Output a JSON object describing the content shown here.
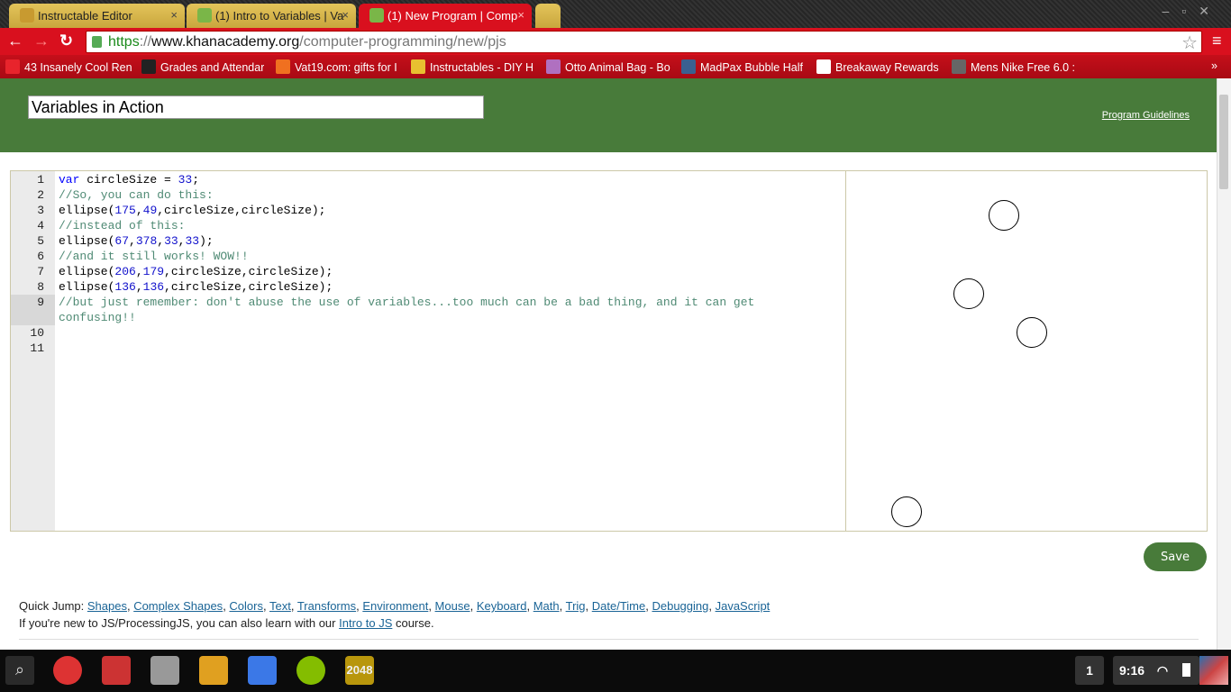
{
  "browser": {
    "tabs": [
      {
        "title": "Instructable Editor",
        "icon": "robot-icon",
        "active": false
      },
      {
        "title": "(1) Intro to Variables | Va",
        "icon": "leaf-icon",
        "active": false
      },
      {
        "title": "(1) New Program | Comp",
        "icon": "leaf-icon",
        "active": true
      }
    ],
    "url": {
      "scheme": "https",
      "sep": "://",
      "domain": "www.khanacademy.org",
      "path": "/computer-programming/new/pjs"
    },
    "bookmarks": [
      {
        "label": "43 Insanely Cool Ren",
        "icon": "bf-icon",
        "color": "#e8242c"
      },
      {
        "label": "Grades and Attendar",
        "icon": "p-icon",
        "color": "#222"
      },
      {
        "label": "Vat19.com: gifts for I",
        "icon": "cart-play-icon",
        "color": "#f07020"
      },
      {
        "label": "Instructables - DIY H",
        "icon": "robot-icon",
        "color": "#e8c030"
      },
      {
        "label": "Otto Animal Bag - Bo",
        "icon": "cart-icon",
        "color": "#b070c0"
      },
      {
        "label": "MadPax Bubble Half",
        "icon": "z-icon",
        "color": "#3a6090"
      },
      {
        "label": "Breakaway Rewards",
        "icon": "shirt-icon",
        "color": "#fff"
      },
      {
        "label": "Mens Nike Free 6.0 :",
        "icon": "nike-icon",
        "color": "#666"
      }
    ],
    "more": "»"
  },
  "header": {
    "program_title": "Variables in Action",
    "guidelines": "Program Guidelines"
  },
  "editor": {
    "line_numbers": [
      "1",
      "2",
      "3",
      "4",
      "5",
      "6",
      "7",
      "8",
      "9",
      "10",
      "11"
    ],
    "lines": [
      [
        [
          "k",
          "var"
        ],
        [
          "t",
          " circleSize = "
        ],
        [
          "n",
          "33"
        ],
        [
          "t",
          ";"
        ]
      ],
      [
        [
          "c",
          "//So, you can do this:"
        ]
      ],
      [
        [
          "t",
          "ellipse("
        ],
        [
          "n",
          "175"
        ],
        [
          "t",
          ","
        ],
        [
          "n",
          "49"
        ],
        [
          "t",
          ",circleSize,circleSize);"
        ]
      ],
      [
        [
          "c",
          "//instead of this:"
        ]
      ],
      [
        [
          "t",
          "ellipse("
        ],
        [
          "n",
          "67"
        ],
        [
          "t",
          ","
        ],
        [
          "n",
          "378"
        ],
        [
          "t",
          ","
        ],
        [
          "n",
          "33"
        ],
        [
          "t",
          ","
        ],
        [
          "n",
          "33"
        ],
        [
          "t",
          ");"
        ]
      ],
      [
        [
          "c",
          "//and it still works! WOW!!"
        ]
      ],
      [
        [
          "t",
          "ellipse("
        ],
        [
          "n",
          "206"
        ],
        [
          "t",
          ","
        ],
        [
          "n",
          "179"
        ],
        [
          "t",
          ",circleSize,circleSize);"
        ]
      ],
      [
        [
          "t",
          "ellipse("
        ],
        [
          "n",
          "136"
        ],
        [
          "t",
          ","
        ],
        [
          "n",
          "136"
        ],
        [
          "t",
          ",circleSize,circleSize);"
        ]
      ],
      [
        [
          "c",
          "//but just remember: don't abuse the use of variables...too much can be a bad thing, and it can get confusing!!"
        ]
      ],
      [],
      []
    ],
    "active_line": 9
  },
  "canvas": {
    "ellipses": [
      [
        175,
        49,
        33,
        33
      ],
      [
        67,
        378,
        33,
        33
      ],
      [
        206,
        179,
        33,
        33
      ],
      [
        136,
        136,
        33,
        33
      ]
    ]
  },
  "save_label": "Save",
  "quick_jump": {
    "prefix": "Quick Jump: ",
    "links": [
      "Shapes",
      "Complex Shapes",
      "Colors",
      "Text",
      "Transforms",
      "Environment",
      "Mouse",
      "Keyboard",
      "Math",
      "Trig",
      "Date/Time",
      "Debugging",
      "JavaScript"
    ],
    "intro_prefix": "If you're new to JS/ProcessingJS, you can also learn with our ",
    "intro_link": "Intro to JS",
    "intro_suffix": " course."
  },
  "shelf": {
    "apps": [
      {
        "name": "chrome",
        "color": "#d33"
      },
      {
        "name": "gmail",
        "color": "#c33"
      },
      {
        "name": "web-store",
        "color": "#999"
      },
      {
        "name": "slides",
        "color": "#e0a020"
      },
      {
        "name": "docs",
        "color": "#3b78e7"
      },
      {
        "name": "spotify",
        "color": "#84bd00"
      },
      {
        "name": "2048",
        "color": "#b8960c",
        "label": "2048"
      }
    ],
    "workspace": "1",
    "time": "9:16"
  }
}
